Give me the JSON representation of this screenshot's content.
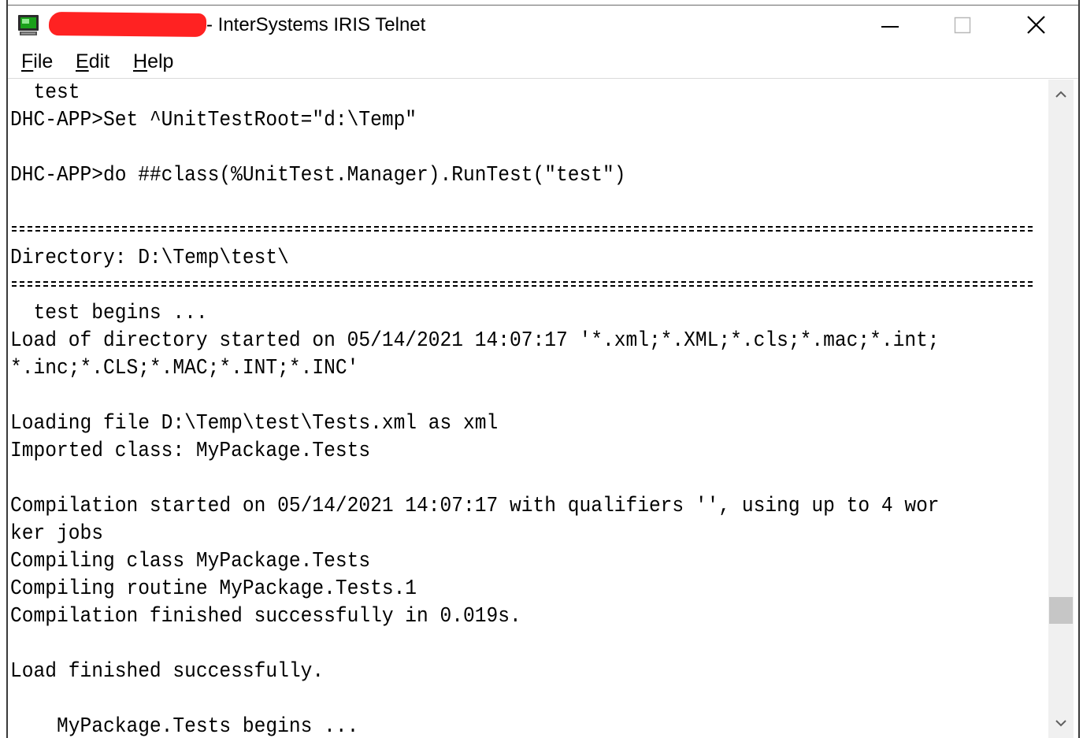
{
  "window": {
    "title": "- InterSystems IRIS Telnet",
    "controls": {
      "minimize": "minimize-icon",
      "maximize": "maximize-icon",
      "close": "close-icon"
    }
  },
  "menu": {
    "file": {
      "mnemonic": "F",
      "rest": "ile"
    },
    "edit": {
      "mnemonic": "E",
      "rest": "dit"
    },
    "help": {
      "mnemonic": "H",
      "rest": "elp"
    }
  },
  "terminal": {
    "lines": [
      "  test",
      "DHC-APP>Set ^UnitTestRoot=\"d:\\Temp\"",
      "",
      "DHC-APP>do ##class(%UnitTest.Manager).RunTest(\"test\")",
      "",
      "",
      "Directory: D:\\Temp\\test\\",
      "",
      "  test begins ...",
      "Load of directory started on 05/14/2021 14:07:17 '*.xml;*.XML;*.cls;*.mac;*.int;",
      "*.inc;*.CLS;*.MAC;*.INT;*.INC'",
      "",
      "Loading file D:\\Temp\\test\\Tests.xml as xml",
      "Imported class: MyPackage.Tests",
      "",
      "Compilation started on 05/14/2021 14:07:17 with qualifiers '', using up to 4 wor",
      "ker jobs",
      "Compiling class MyPackage.Tests",
      "Compiling routine MyPackage.Tests.1",
      "Compilation finished successfully in 0.019s.",
      "",
      "Load finished successfully.",
      "",
      "    MyPackage.Tests begins ..."
    ],
    "separator_rows": [
      5,
      7
    ]
  },
  "scrollbar": {
    "up_icon": "chevron-up-icon",
    "down_icon": "chevron-down-icon",
    "position_fraction": 0.8
  },
  "colors": {
    "text": "#000000",
    "background": "#ffffff",
    "redaction": "#ff2222",
    "scrollbar_track": "#f0f0f0",
    "scrollbar_thumb": "#c6c6c6"
  }
}
